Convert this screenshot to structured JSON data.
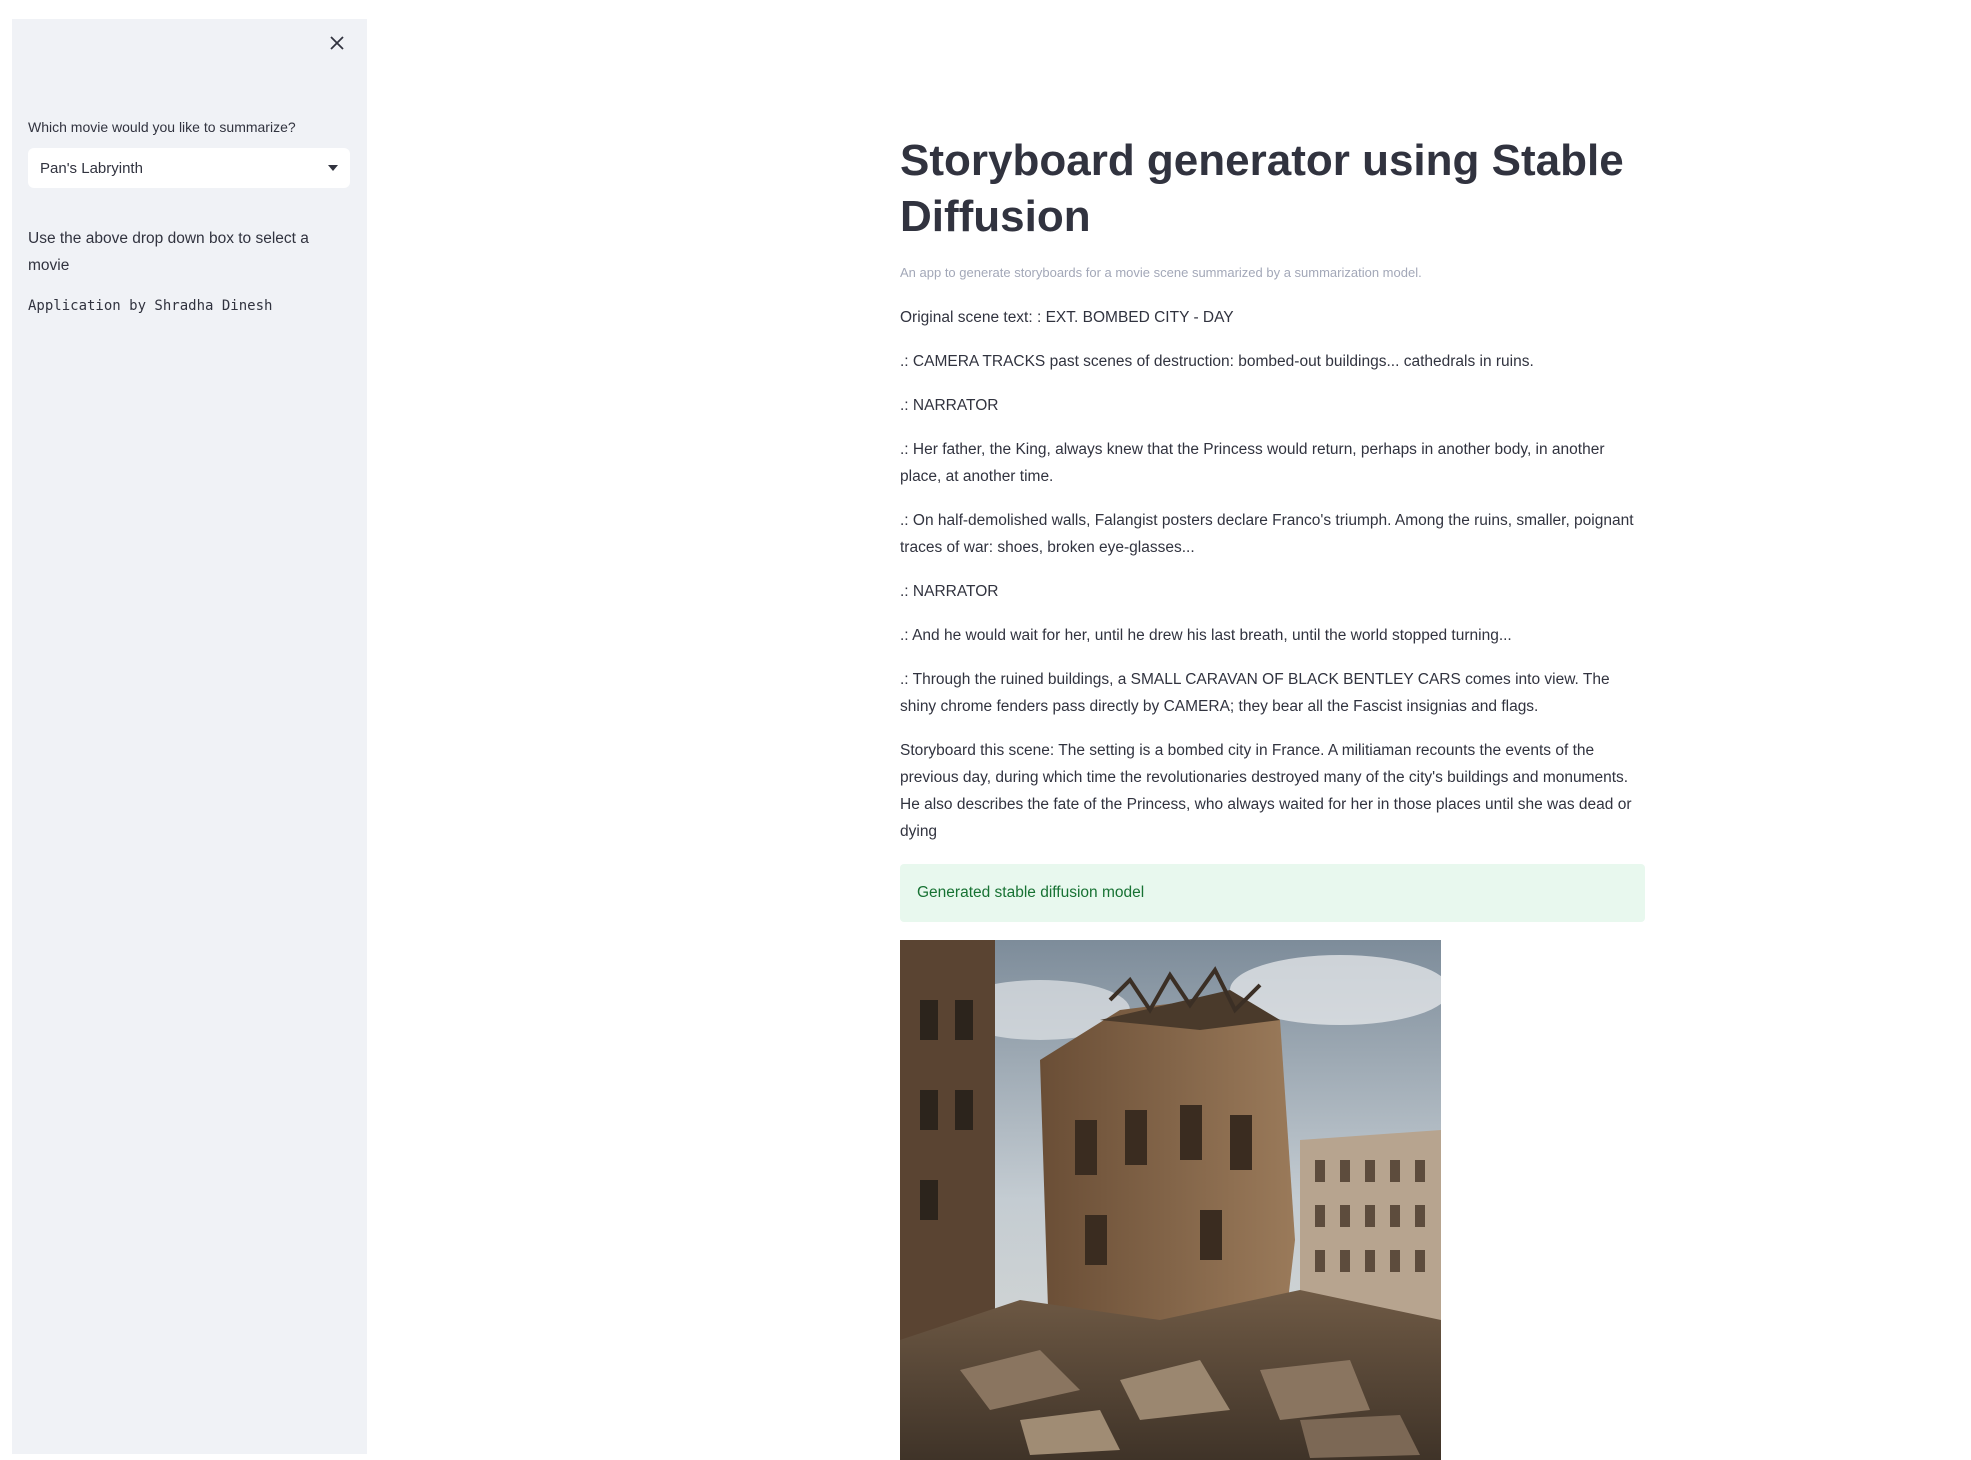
{
  "sidebar": {
    "select_label": "Which movie would you like to summarize?",
    "selected_movie": "Pan's Labryinth",
    "help_text": "Use the above drop down box to select a movie",
    "credit": "Application by Shradha Dinesh",
    "close_icon": "close-icon",
    "dropdown_icon": "chevron-down-icon"
  },
  "main": {
    "title": "Storyboard generator using Stable Diffusion",
    "subtitle": "An app to generate storyboards for a movie scene summarized by a summarization model.",
    "scene_paragraphs": [
      "Original scene text: : EXT. BOMBED CITY - DAY",
      ".: CAMERA TRACKS past scenes of destruction: bombed-out buildings... cathedrals in ruins.",
      ".: NARRATOR",
      ".: Her father, the King, always knew that the Princess would return, perhaps in another body, in another place, at another time.",
      ".: On half-demolished walls, Falangist posters declare Franco's triumph. Among the ruins, smaller, poignant traces of war: shoes, broken eye-glasses...",
      ".: NARRATOR",
      ".: And he would wait for her, until he drew his last breath, until the world stopped turning...",
      ".: Through the ruined buildings, a SMALL CARAVAN OF BLACK BENTLEY CARS comes into view. The shiny chrome fenders pass directly by CAMERA; they bear all the Fascist insignias and flags.",
      "Storyboard this scene: The setting is a bombed city in France. A militiaman recounts the events of the previous day, during which time the revolutionaries destroyed many of the city's buildings and monuments. He also describes the fate of the Princess, who always waited for her in those places until she was dead or dying"
    ],
    "success_message": "Generated stable diffusion model"
  },
  "colors": {
    "sidebar_bg": "#f0f2f6",
    "text": "#31333f",
    "subtitle": "#a3a8b8",
    "success_bg": "#e8f8ee",
    "success_text": "#177233"
  }
}
